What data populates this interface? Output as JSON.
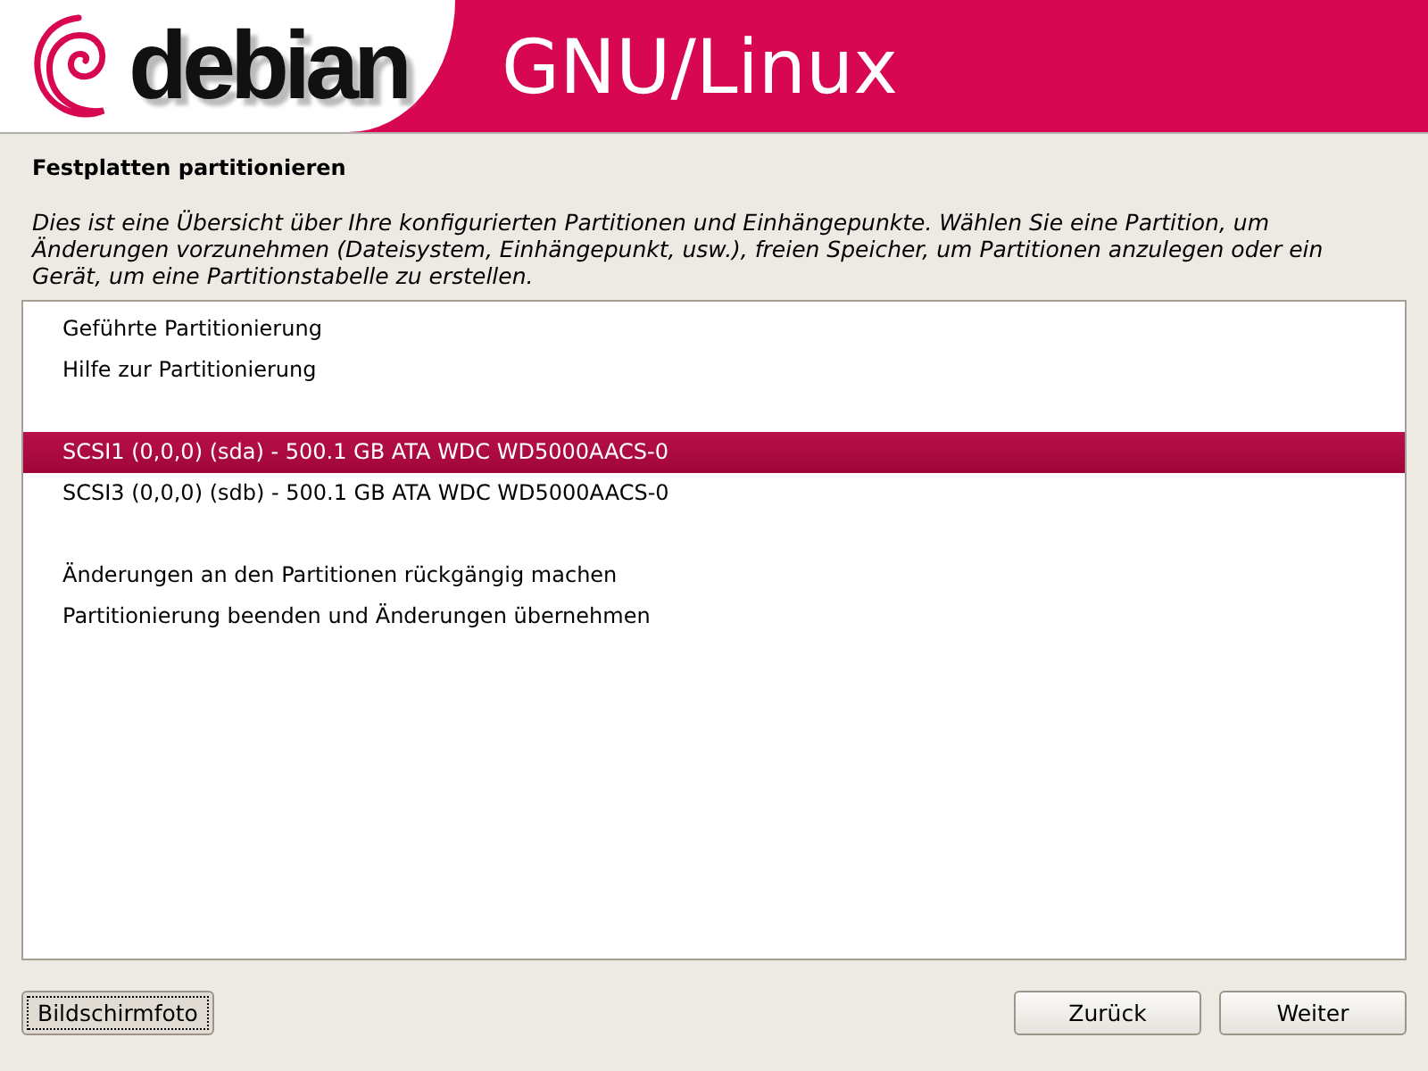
{
  "header": {
    "logo": "debian",
    "title": "GNU/Linux"
  },
  "page": {
    "title": "Festplatten partitionieren",
    "description": "Dies ist eine Übersicht über Ihre konfigurierten Partitionen und Einhängepunkte. Wählen Sie eine Partition, um Änderungen vorzunehmen (Dateisystem, Einhängepunkt, usw.), freien Speicher, um Partitionen anzulegen oder ein Gerät, um eine Partitionstabelle zu erstellen."
  },
  "list_groups": [
    [
      {
        "label": "Geführte Partitionierung",
        "selected": false
      },
      {
        "label": "Hilfe zur Partitionierung",
        "selected": false
      }
    ],
    [
      {
        "label": "SCSI1 (0,0,0) (sda) - 500.1 GB ATA WDC WD5000AACS-0",
        "selected": true
      },
      {
        "label": "SCSI3 (0,0,0) (sdb) - 500.1 GB ATA WDC WD5000AACS-0",
        "selected": false
      }
    ],
    [
      {
        "label": "Änderungen an den Partitionen rückgängig machen",
        "selected": false
      },
      {
        "label": "Partitionierung beenden und Änderungen übernehmen",
        "selected": false
      }
    ]
  ],
  "buttons_left": [
    {
      "label": "Bildschirmfoto",
      "focused": true
    }
  ],
  "buttons_right": [
    {
      "label": "Zurück",
      "focused": false
    },
    {
      "label": "Weiter",
      "focused": false
    }
  ]
}
